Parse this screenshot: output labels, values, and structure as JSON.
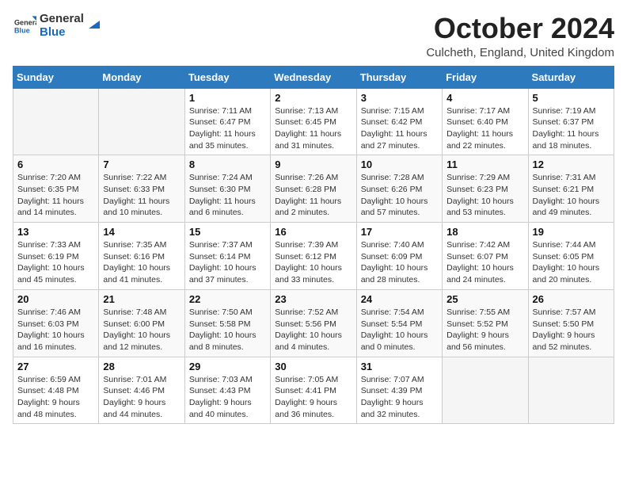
{
  "logo": {
    "general": "General",
    "blue": "Blue"
  },
  "header": {
    "month": "October 2024",
    "location": "Culcheth, England, United Kingdom"
  },
  "days_of_week": [
    "Sunday",
    "Monday",
    "Tuesday",
    "Wednesday",
    "Thursday",
    "Friday",
    "Saturday"
  ],
  "weeks": [
    [
      {
        "day": "",
        "info": ""
      },
      {
        "day": "",
        "info": ""
      },
      {
        "day": "1",
        "sunrise": "Sunrise: 7:11 AM",
        "sunset": "Sunset: 6:47 PM",
        "daylight": "Daylight: 11 hours and 35 minutes."
      },
      {
        "day": "2",
        "sunrise": "Sunrise: 7:13 AM",
        "sunset": "Sunset: 6:45 PM",
        "daylight": "Daylight: 11 hours and 31 minutes."
      },
      {
        "day": "3",
        "sunrise": "Sunrise: 7:15 AM",
        "sunset": "Sunset: 6:42 PM",
        "daylight": "Daylight: 11 hours and 27 minutes."
      },
      {
        "day": "4",
        "sunrise": "Sunrise: 7:17 AM",
        "sunset": "Sunset: 6:40 PM",
        "daylight": "Daylight: 11 hours and 22 minutes."
      },
      {
        "day": "5",
        "sunrise": "Sunrise: 7:19 AM",
        "sunset": "Sunset: 6:37 PM",
        "daylight": "Daylight: 11 hours and 18 minutes."
      }
    ],
    [
      {
        "day": "6",
        "sunrise": "Sunrise: 7:20 AM",
        "sunset": "Sunset: 6:35 PM",
        "daylight": "Daylight: 11 hours and 14 minutes."
      },
      {
        "day": "7",
        "sunrise": "Sunrise: 7:22 AM",
        "sunset": "Sunset: 6:33 PM",
        "daylight": "Daylight: 11 hours and 10 minutes."
      },
      {
        "day": "8",
        "sunrise": "Sunrise: 7:24 AM",
        "sunset": "Sunset: 6:30 PM",
        "daylight": "Daylight: 11 hours and 6 minutes."
      },
      {
        "day": "9",
        "sunrise": "Sunrise: 7:26 AM",
        "sunset": "Sunset: 6:28 PM",
        "daylight": "Daylight: 11 hours and 2 minutes."
      },
      {
        "day": "10",
        "sunrise": "Sunrise: 7:28 AM",
        "sunset": "Sunset: 6:26 PM",
        "daylight": "Daylight: 10 hours and 57 minutes."
      },
      {
        "day": "11",
        "sunrise": "Sunrise: 7:29 AM",
        "sunset": "Sunset: 6:23 PM",
        "daylight": "Daylight: 10 hours and 53 minutes."
      },
      {
        "day": "12",
        "sunrise": "Sunrise: 7:31 AM",
        "sunset": "Sunset: 6:21 PM",
        "daylight": "Daylight: 10 hours and 49 minutes."
      }
    ],
    [
      {
        "day": "13",
        "sunrise": "Sunrise: 7:33 AM",
        "sunset": "Sunset: 6:19 PM",
        "daylight": "Daylight: 10 hours and 45 minutes."
      },
      {
        "day": "14",
        "sunrise": "Sunrise: 7:35 AM",
        "sunset": "Sunset: 6:16 PM",
        "daylight": "Daylight: 10 hours and 41 minutes."
      },
      {
        "day": "15",
        "sunrise": "Sunrise: 7:37 AM",
        "sunset": "Sunset: 6:14 PM",
        "daylight": "Daylight: 10 hours and 37 minutes."
      },
      {
        "day": "16",
        "sunrise": "Sunrise: 7:39 AM",
        "sunset": "Sunset: 6:12 PM",
        "daylight": "Daylight: 10 hours and 33 minutes."
      },
      {
        "day": "17",
        "sunrise": "Sunrise: 7:40 AM",
        "sunset": "Sunset: 6:09 PM",
        "daylight": "Daylight: 10 hours and 28 minutes."
      },
      {
        "day": "18",
        "sunrise": "Sunrise: 7:42 AM",
        "sunset": "Sunset: 6:07 PM",
        "daylight": "Daylight: 10 hours and 24 minutes."
      },
      {
        "day": "19",
        "sunrise": "Sunrise: 7:44 AM",
        "sunset": "Sunset: 6:05 PM",
        "daylight": "Daylight: 10 hours and 20 minutes."
      }
    ],
    [
      {
        "day": "20",
        "sunrise": "Sunrise: 7:46 AM",
        "sunset": "Sunset: 6:03 PM",
        "daylight": "Daylight: 10 hours and 16 minutes."
      },
      {
        "day": "21",
        "sunrise": "Sunrise: 7:48 AM",
        "sunset": "Sunset: 6:00 PM",
        "daylight": "Daylight: 10 hours and 12 minutes."
      },
      {
        "day": "22",
        "sunrise": "Sunrise: 7:50 AM",
        "sunset": "Sunset: 5:58 PM",
        "daylight": "Daylight: 10 hours and 8 minutes."
      },
      {
        "day": "23",
        "sunrise": "Sunrise: 7:52 AM",
        "sunset": "Sunset: 5:56 PM",
        "daylight": "Daylight: 10 hours and 4 minutes."
      },
      {
        "day": "24",
        "sunrise": "Sunrise: 7:54 AM",
        "sunset": "Sunset: 5:54 PM",
        "daylight": "Daylight: 10 hours and 0 minutes."
      },
      {
        "day": "25",
        "sunrise": "Sunrise: 7:55 AM",
        "sunset": "Sunset: 5:52 PM",
        "daylight": "Daylight: 9 hours and 56 minutes."
      },
      {
        "day": "26",
        "sunrise": "Sunrise: 7:57 AM",
        "sunset": "Sunset: 5:50 PM",
        "daylight": "Daylight: 9 hours and 52 minutes."
      }
    ],
    [
      {
        "day": "27",
        "sunrise": "Sunrise: 6:59 AM",
        "sunset": "Sunset: 4:48 PM",
        "daylight": "Daylight: 9 hours and 48 minutes."
      },
      {
        "day": "28",
        "sunrise": "Sunrise: 7:01 AM",
        "sunset": "Sunset: 4:46 PM",
        "daylight": "Daylight: 9 hours and 44 minutes."
      },
      {
        "day": "29",
        "sunrise": "Sunrise: 7:03 AM",
        "sunset": "Sunset: 4:43 PM",
        "daylight": "Daylight: 9 hours and 40 minutes."
      },
      {
        "day": "30",
        "sunrise": "Sunrise: 7:05 AM",
        "sunset": "Sunset: 4:41 PM",
        "daylight": "Daylight: 9 hours and 36 minutes."
      },
      {
        "day": "31",
        "sunrise": "Sunrise: 7:07 AM",
        "sunset": "Sunset: 4:39 PM",
        "daylight": "Daylight: 9 hours and 32 minutes."
      },
      {
        "day": "",
        "info": ""
      },
      {
        "day": "",
        "info": ""
      }
    ]
  ]
}
